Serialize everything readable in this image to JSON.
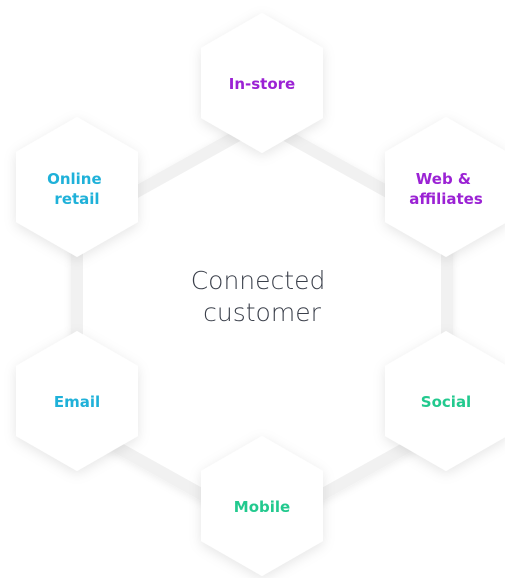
{
  "center": {
    "line1": "Connected",
    "line2": "customer"
  },
  "nodes": [
    {
      "id": "in-store",
      "lines": [
        "In-store"
      ],
      "color": "#9b22d4"
    },
    {
      "id": "web-affiliates",
      "lines": [
        "Web &",
        "affiliates"
      ],
      "color": "#9b22d4"
    },
    {
      "id": "social",
      "lines": [
        "Social"
      ],
      "color": "#22c98e"
    },
    {
      "id": "mobile",
      "lines": [
        "Mobile"
      ],
      "color": "#22c98e"
    },
    {
      "id": "email",
      "lines": [
        "Email"
      ],
      "color": "#1fb1d9"
    },
    {
      "id": "online-retail",
      "lines": [
        "Online",
        "retail"
      ],
      "color": "#1fb1d9"
    }
  ]
}
